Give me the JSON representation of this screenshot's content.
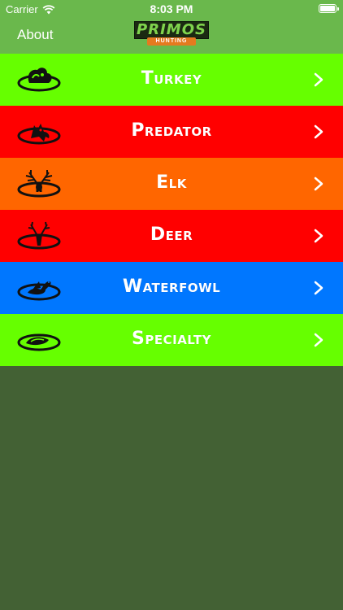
{
  "status_bar": {
    "carrier": "Carrier",
    "time": "8:03 PM"
  },
  "header": {
    "about_label": "About",
    "logo_text": "PRIMOS",
    "logo_subtext": "HUNTING"
  },
  "categories": [
    {
      "label": "Turkey",
      "color": "#66ff00",
      "icon": "turkey-icon"
    },
    {
      "label": "Predator",
      "color": "#ff0000",
      "icon": "predator-icon"
    },
    {
      "label": "Elk",
      "color": "#ff6600",
      "icon": "elk-icon"
    },
    {
      "label": "Deer",
      "color": "#ff0000",
      "icon": "deer-icon"
    },
    {
      "label": "Waterfowl",
      "color": "#0077ff",
      "icon": "waterfowl-icon"
    },
    {
      "label": "Specialty",
      "color": "#66ff00",
      "icon": "specialty-icon"
    }
  ],
  "colors": {
    "header_bg": "#6ab84c",
    "background": "#436134"
  }
}
